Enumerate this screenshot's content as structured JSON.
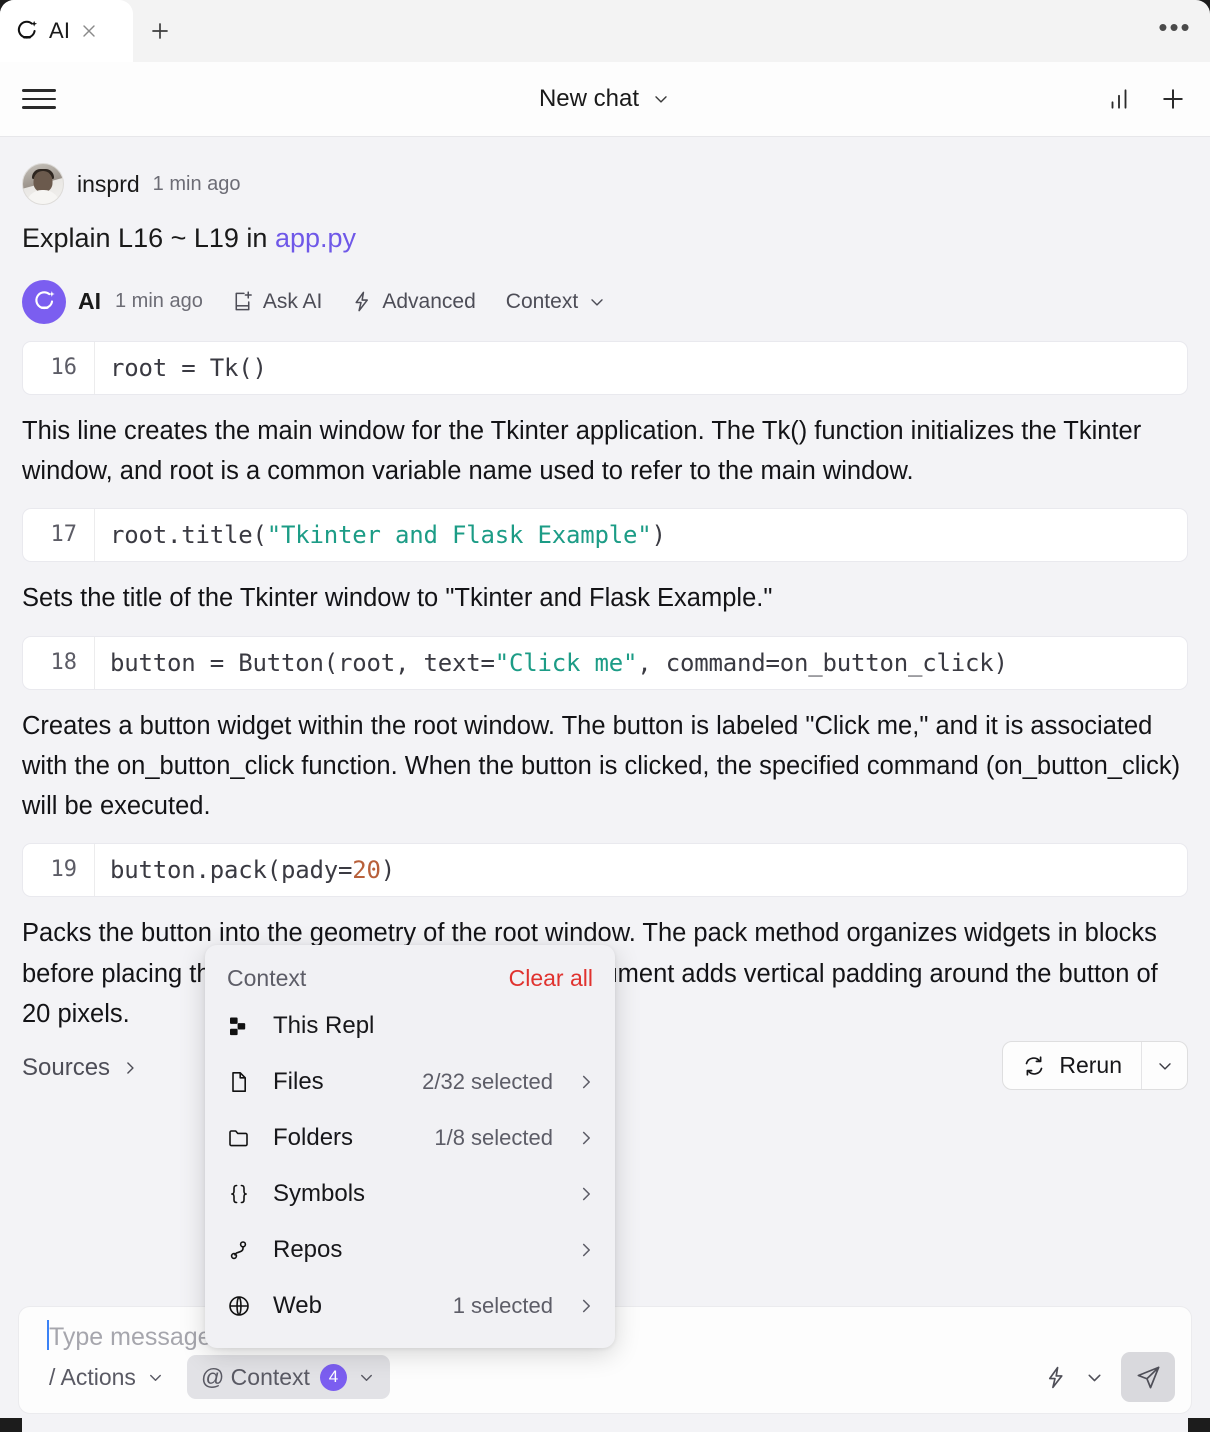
{
  "window": {
    "tab": {
      "label": "AI",
      "logo_icon": "replit-ai-logo-icon",
      "close_icon": "close-icon"
    },
    "new_tab_icon": "plus-icon",
    "more_icon": "ellipsis-icon",
    "more_label": "•••"
  },
  "header": {
    "menu_icon": "hamburger-icon",
    "title": "New chat",
    "title_chevron_icon": "chevron-down-icon",
    "stats_icon": "bar-chart-icon",
    "new_chat_icon": "plus-icon"
  },
  "conversation": {
    "user": {
      "avatar_icon": "user-avatar",
      "name": "insprd",
      "time": "1 min ago",
      "query_prefix": "Explain L16 ~ L19 in",
      "query_file": "app.py"
    },
    "assistant": {
      "avatar_icon": "replit-ai-logo-icon",
      "name": "AI",
      "time": "1 min ago",
      "actions": [
        {
          "label": "Ask AI",
          "icon": "new-note-icon"
        },
        {
          "label": "Advanced",
          "icon": "lightning-icon"
        },
        {
          "label": "Context",
          "icon": "chevron-down-icon"
        }
      ]
    },
    "blocks": [
      {
        "line_no": "16",
        "code_plain": "root = Tk()",
        "explanation": "This line creates the main window for the Tkinter application. The Tk() function initializes the Tkinter window, and root is a common variable name used to refer to the main window."
      },
      {
        "line_no": "17",
        "code_pre": "root.title(",
        "code_str": "\"Tkinter and Flask Example\"",
        "code_post": ")",
        "explanation": "Sets the title of the Tkinter window to \"Tkinter and Flask Example.\""
      },
      {
        "line_no": "18",
        "code_pre": "button = Button(root, text=",
        "code_str": "\"Click me\"",
        "code_post": ", command=on_button_click)",
        "explanation": "Creates a button widget within the root window. The button is labeled \"Click me,\" and it is associated with the on_button_click function. When the button is clicked, the specified command (on_button_click) will be executed."
      },
      {
        "line_no": "19",
        "code_pre": "button.pack(pady=",
        "code_num": "20",
        "code_post": ")",
        "explanation": "Packs the button into the geometry of the root window. The pack method organizes widgets in blocks before placing them in the widget. The pady=20 argument adds vertical padding around the button of 20 pixels."
      }
    ],
    "sources_label": "Sources",
    "sources_arrow_icon": "chevron-right-icon",
    "rerun": {
      "label": "Rerun",
      "icon": "refresh-icon",
      "caret_icon": "chevron-down-icon"
    }
  },
  "context_popup": {
    "title": "Context",
    "clear_all": "Clear all",
    "clear_all_color": "#e0322e",
    "items": [
      {
        "label": "This Repl",
        "count": "",
        "icon": "replit-logo-icon",
        "arrow": false
      },
      {
        "label": "Files",
        "count": "2/32 selected",
        "icon": "file-icon",
        "arrow": true
      },
      {
        "label": "Folders",
        "count": "1/8 selected",
        "icon": "folder-icon",
        "arrow": true
      },
      {
        "label": "Symbols",
        "count": "",
        "icon": "braces-icon",
        "arrow": true
      },
      {
        "label": "Repos",
        "count": "",
        "icon": "git-branch-icon",
        "arrow": true
      },
      {
        "label": "Web",
        "count": "1 selected",
        "icon": "globe-icon",
        "arrow": true
      }
    ]
  },
  "composer": {
    "placeholder": "Type message or / for actions",
    "actions_chip": {
      "label": "/ Actions",
      "caret_icon": "chevron-down-icon"
    },
    "context_chip": {
      "label": "@ Context",
      "badge": "4",
      "caret_icon": "chevron-down-icon"
    },
    "advanced_icon": "lightning-icon",
    "advanced_caret_icon": "chevron-down-icon",
    "send_icon": "send-icon"
  },
  "colors": {
    "accent_purple": "#7b5ef0",
    "link_purple": "#6f58e8",
    "string_teal": "#1c9c86",
    "number_orange": "#b8603a",
    "danger_red": "#e0322e",
    "page_bg": "#f3f3f6"
  }
}
